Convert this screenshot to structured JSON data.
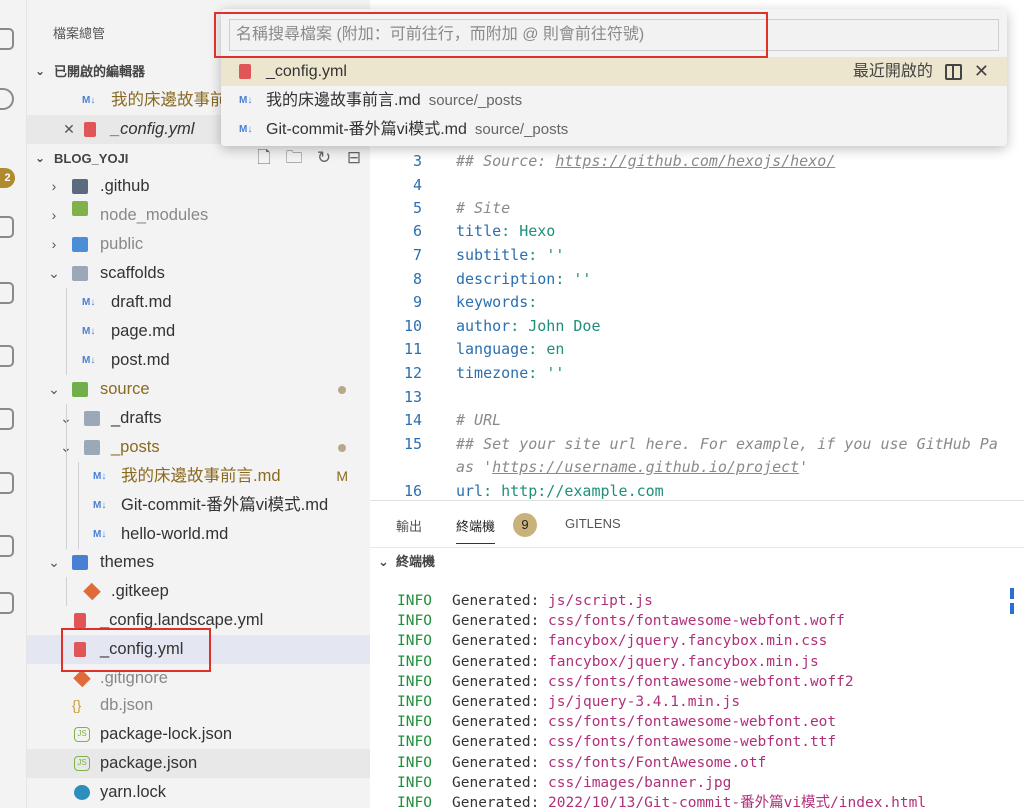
{
  "explorer": {
    "title": "檔案總管",
    "open_editors": {
      "label": "已開啟的編輯器",
      "items": [
        {
          "name": "我的床邊故事前言.md"
        },
        {
          "name": "_config.yml"
        }
      ]
    },
    "project": {
      "label": "BLOG_YOJI",
      "actions": [
        "new-file-icon",
        "new-folder-icon",
        "refresh-icon",
        "collapse-all-icon"
      ]
    },
    "tree": [
      {
        "name": ".github"
      },
      {
        "name": "node_modules"
      },
      {
        "name": "public"
      },
      {
        "name": "scaffolds"
      },
      {
        "name": "draft.md"
      },
      {
        "name": "page.md"
      },
      {
        "name": "post.md"
      },
      {
        "name": "source"
      },
      {
        "name": "_drafts"
      },
      {
        "name": "_posts"
      },
      {
        "name": "我的床邊故事前言.md",
        "badge": "M"
      },
      {
        "name": "Git-commit-番外篇vi模式.md"
      },
      {
        "name": "hello-world.md"
      },
      {
        "name": "themes"
      },
      {
        "name": ".gitkeep"
      },
      {
        "name": "_config.landscape.yml"
      },
      {
        "name": "_config.yml"
      },
      {
        "name": ".gitignore"
      },
      {
        "name": "db.json"
      },
      {
        "name": "package-lock.json"
      },
      {
        "name": "package.json"
      },
      {
        "name": "yarn.lock"
      }
    ]
  },
  "activity_badge": "2",
  "quick_open": {
    "placeholder": "名稱搜尋檔案 (附加：可前往行，而附加 @ 則會前往符號)",
    "recent_label": "最近開啟的",
    "items": [
      {
        "name": "_config.yml",
        "desc": ""
      },
      {
        "name": "我的床邊故事前言.md",
        "desc": "source/_posts"
      },
      {
        "name": "Git-commit-番外篇vi模式.md",
        "desc": "source/_posts"
      }
    ]
  },
  "editor": {
    "lines": [
      {
        "n": "3",
        "parts": [
          [
            "c-com",
            "## Source: "
          ],
          [
            "c-url",
            "https://github.com/hexojs/hexo/"
          ]
        ]
      },
      {
        "n": "4",
        "parts": []
      },
      {
        "n": "5",
        "parts": [
          [
            "c-com",
            "# Site"
          ]
        ]
      },
      {
        "n": "6",
        "parts": [
          [
            "c-key",
            "title"
          ],
          [
            "c-plain",
            ": "
          ],
          [
            "c-str",
            "Hexo"
          ]
        ]
      },
      {
        "n": "7",
        "parts": [
          [
            "c-key",
            "subtitle"
          ],
          [
            "c-plain",
            ": "
          ],
          [
            "c-str",
            "''"
          ]
        ]
      },
      {
        "n": "8",
        "parts": [
          [
            "c-key",
            "description"
          ],
          [
            "c-plain",
            ": "
          ],
          [
            "c-str",
            "''"
          ]
        ]
      },
      {
        "n": "9",
        "parts": [
          [
            "c-key",
            "keywords"
          ],
          [
            "c-plain",
            ":"
          ]
        ]
      },
      {
        "n": "10",
        "parts": [
          [
            "c-key",
            "author"
          ],
          [
            "c-plain",
            ": "
          ],
          [
            "c-str",
            "John Doe"
          ]
        ]
      },
      {
        "n": "11",
        "parts": [
          [
            "c-key",
            "language"
          ],
          [
            "c-plain",
            ": "
          ],
          [
            "c-str",
            "en"
          ]
        ]
      },
      {
        "n": "12",
        "parts": [
          [
            "c-key",
            "timezone"
          ],
          [
            "c-plain",
            ": "
          ],
          [
            "c-str",
            "''"
          ]
        ]
      },
      {
        "n": "13",
        "parts": []
      },
      {
        "n": "14",
        "parts": [
          [
            "c-com",
            "# URL"
          ]
        ]
      },
      {
        "n": "15",
        "parts": [
          [
            "c-com",
            "## Set your site url here. For example, if you use GitHub Pa"
          ]
        ]
      },
      {
        "n": "",
        "parts": [
          [
            "c-com",
            "as '"
          ],
          [
            "c-url",
            "https://username.github.io/project"
          ],
          [
            "c-com",
            "'"
          ]
        ]
      },
      {
        "n": "16",
        "parts": [
          [
            "c-key",
            "url"
          ],
          [
            "c-plain",
            ": "
          ],
          [
            "c-str",
            "http://example.com"
          ]
        ]
      }
    ]
  },
  "panel": {
    "tabs": [
      "輸出",
      "終端機",
      "GITLENS"
    ],
    "badge": "9",
    "section": "終端機",
    "log": [
      {
        "level": "INFO",
        "msg": "Generated:",
        "path": "js/script.js"
      },
      {
        "level": "INFO",
        "msg": "Generated:",
        "path": "css/fonts/fontawesome-webfont.woff"
      },
      {
        "level": "INFO",
        "msg": "Generated:",
        "path": "fancybox/jquery.fancybox.min.css"
      },
      {
        "level": "INFO",
        "msg": "Generated:",
        "path": "fancybox/jquery.fancybox.min.js"
      },
      {
        "level": "INFO",
        "msg": "Generated:",
        "path": "css/fonts/fontawesome-webfont.woff2"
      },
      {
        "level": "INFO",
        "msg": "Generated:",
        "path": "js/jquery-3.4.1.min.js"
      },
      {
        "level": "INFO",
        "msg": "Generated:",
        "path": "css/fonts/fontawesome-webfont.eot"
      },
      {
        "level": "INFO",
        "msg": "Generated:",
        "path": "css/fonts/fontawesome-webfont.ttf"
      },
      {
        "level": "INFO",
        "msg": "Generated:",
        "path": "css/fonts/FontAwesome.otf"
      },
      {
        "level": "INFO",
        "msg": "Generated:",
        "path": "css/images/banner.jpg"
      },
      {
        "level": "INFO",
        "msg": "Generated:",
        "path": "2022/10/13/Git-commit-番外篇vi模式/index.html"
      }
    ]
  },
  "colors": {
    "highlight_box": "#e0302a",
    "selected_row": "#e4e6f1",
    "quick_open_active": "#ede6cf"
  }
}
